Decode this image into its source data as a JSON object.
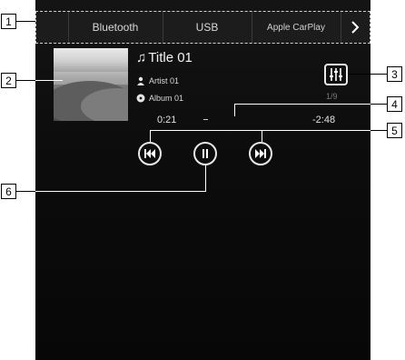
{
  "tabs": {
    "items": [
      "Bluetooth",
      "USB",
      "Apple CarPlay"
    ],
    "more_icon": "chevron-right-icon"
  },
  "callouts": [
    "1",
    "2",
    "3",
    "4",
    "5",
    "6"
  ],
  "track": {
    "title": "Title 01",
    "artist": "Artist 01",
    "album": "Album 01",
    "elapsed": "0:21",
    "remaining": "-2:48",
    "index": "1/9"
  },
  "icons": {
    "title": "music-note-icon",
    "artist": "person-icon",
    "album": "disc-icon",
    "settings": "equalizer-icon",
    "prev": "previous-track-icon",
    "pause": "pause-icon",
    "next": "next-track-icon"
  }
}
